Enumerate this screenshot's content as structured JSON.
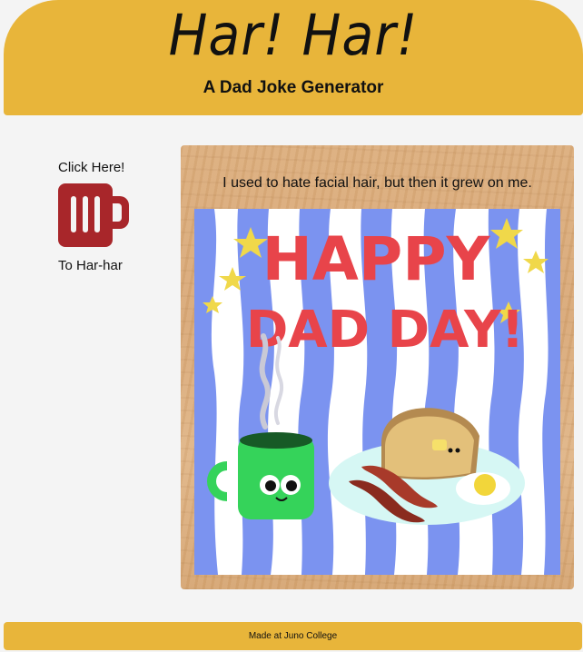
{
  "header": {
    "title": "Har! Har!",
    "subtitle": "A Dad Joke Generator"
  },
  "sidebar": {
    "top_label": "Click Here!",
    "button_icon": "beer-mug-icon",
    "bottom_label": "To Har-har"
  },
  "joke": {
    "text": "I used to hate facial hair, but then it grew on me."
  },
  "card_image": {
    "line1": "HAPPY",
    "line2": "DAD DAY!"
  },
  "footer": {
    "text": "Made at Juno College"
  },
  "colors": {
    "header_bg": "#e8b53a",
    "mug_red": "#a8262a",
    "stripe_blue": "#7b93f0",
    "happy_red": "#e8444a"
  }
}
